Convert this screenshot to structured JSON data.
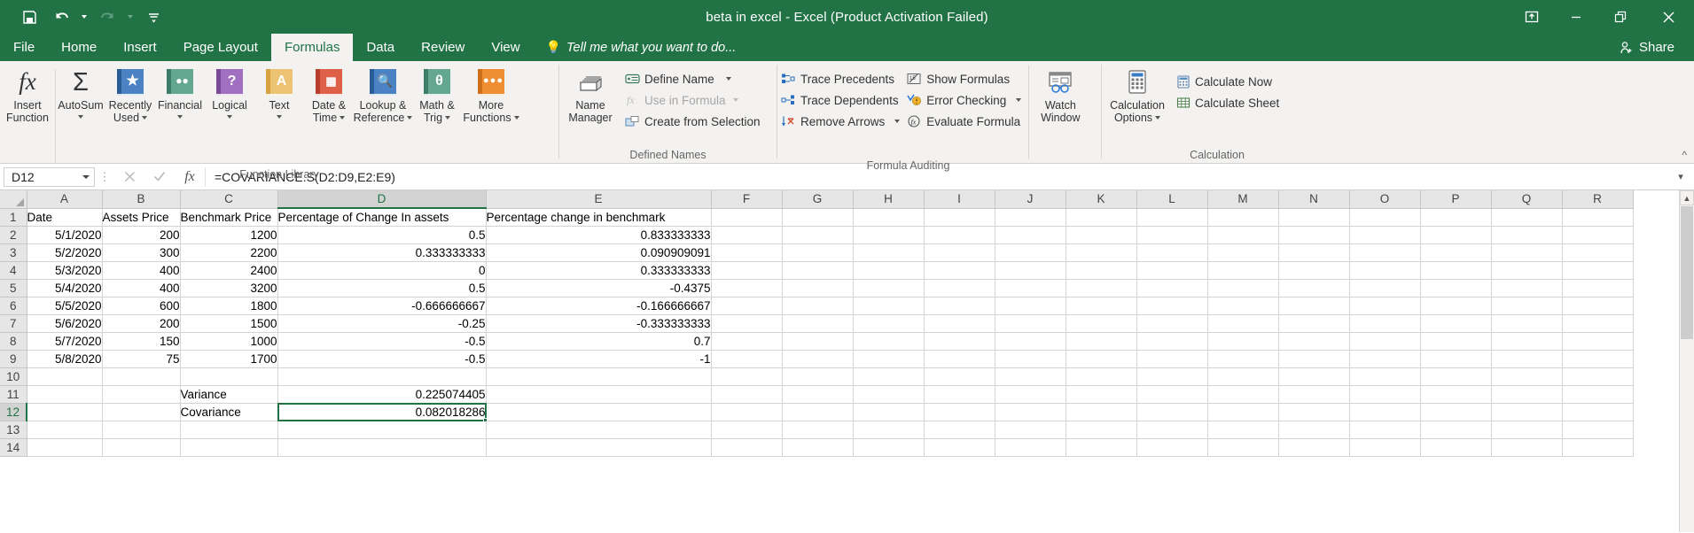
{
  "window": {
    "title": "beta in excel - Excel (Product Activation Failed)",
    "quick_access": [
      "save-icon",
      "undo-icon",
      "redo-icon",
      "customize-icon"
    ],
    "controls": {
      "ribbon_display": "ribbon-display-options-icon",
      "minimize": "minimize-icon",
      "restore": "restore-icon",
      "close": "close-icon"
    }
  },
  "tabs": {
    "items": [
      {
        "label": "File",
        "active": false
      },
      {
        "label": "Home",
        "active": false
      },
      {
        "label": "Insert",
        "active": false
      },
      {
        "label": "Page Layout",
        "active": false
      },
      {
        "label": "Formulas",
        "active": true
      },
      {
        "label": "Data",
        "active": false
      },
      {
        "label": "Review",
        "active": false
      },
      {
        "label": "View",
        "active": false
      }
    ],
    "tell_me": "Tell me what you want to do...",
    "share": "Share"
  },
  "ribbon": {
    "groups": [
      {
        "name": "Function Library",
        "label": "Function Library",
        "buttons": [
          {
            "label_line1": "Insert",
            "label_line2": "Function",
            "icon": "fx-icon",
            "caret": false,
            "color": ""
          },
          {
            "label_line1": "AutoSum",
            "label_line2": "",
            "icon": "sigma-icon",
            "caret": true,
            "color": ""
          },
          {
            "label_line1": "Recently",
            "label_line2": "Used",
            "icon": "star-book-icon",
            "caret": true,
            "color": "#3a6fb0"
          },
          {
            "label_line1": "Financial",
            "label_line2": "",
            "icon": "coins-book-icon",
            "caret": true,
            "color": "#4f9e86"
          },
          {
            "label_line1": "Logical",
            "label_line2": "",
            "icon": "question-book-icon",
            "caret": true,
            "color": "#9a62b5"
          },
          {
            "label_line1": "Text",
            "label_line2": "",
            "icon": "letter-a-book-icon",
            "caret": true,
            "color": "#e9b65b"
          },
          {
            "label_line1": "Date &",
            "label_line2": "Time",
            "icon": "calendar-book-icon",
            "caret": true,
            "color": "#d9503c"
          },
          {
            "label_line1": "Lookup &",
            "label_line2": "Reference",
            "icon": "magnifier-book-icon",
            "caret": true,
            "color": "#3a6fb0"
          },
          {
            "label_line1": "Math &",
            "label_line2": "Trig",
            "icon": "theta-book-icon",
            "caret": true,
            "color": "#4f9e86"
          },
          {
            "label_line1": "More",
            "label_line2": "Functions",
            "icon": "ellipsis-book-icon",
            "caret": true,
            "color": "#e8862a"
          }
        ]
      },
      {
        "name": "Defined Names",
        "label": "Defined Names",
        "big_button": {
          "label_line1": "Name",
          "label_line2": "Manager",
          "icon": "name-manager-icon"
        },
        "small_buttons": [
          {
            "label": "Define Name",
            "icon": "define-name-icon",
            "caret": true,
            "disabled": false
          },
          {
            "label": "Use in Formula",
            "icon": "use-in-formula-icon",
            "caret": true,
            "disabled": true
          },
          {
            "label": "Create from Selection",
            "icon": "create-from-selection-icon",
            "caret": false,
            "disabled": false
          }
        ]
      },
      {
        "name": "Formula Auditing",
        "label": "Formula Auditing",
        "small_buttons_col1": [
          {
            "label": "Trace Precedents",
            "icon": "trace-precedents-icon",
            "caret": false
          },
          {
            "label": "Trace Dependents",
            "icon": "trace-dependents-icon",
            "caret": false
          },
          {
            "label": "Remove Arrows",
            "icon": "remove-arrows-icon",
            "caret": true
          }
        ],
        "small_buttons_col2": [
          {
            "label": "Show Formulas",
            "icon": "show-formulas-icon",
            "caret": false
          },
          {
            "label": "Error Checking",
            "icon": "error-checking-icon",
            "caret": true
          },
          {
            "label": "Evaluate Formula",
            "icon": "evaluate-formula-icon",
            "caret": false
          }
        ],
        "watch_window": {
          "label_line1": "Watch",
          "label_line2": "Window",
          "icon": "watch-window-icon"
        }
      },
      {
        "name": "Calculation",
        "label": "Calculation",
        "big_button": {
          "label_line1": "Calculation",
          "label_line2": "Options",
          "icon": "calculator-icon",
          "caret": true
        },
        "small_buttons": [
          {
            "label": "Calculate Now",
            "icon": "calculate-now-icon"
          },
          {
            "label": "Calculate Sheet",
            "icon": "calculate-sheet-icon"
          }
        ]
      }
    ]
  },
  "formula_bar": {
    "name_box": "D12",
    "cancel_icon": "cancel-icon",
    "enter_icon": "confirm-icon",
    "fx_icon": "insert-function-icon",
    "formula": "=COVARIANCE.S(D2:D9,E2:E9)",
    "expand_icon": "expand-formula-bar-icon"
  },
  "sheet": {
    "columns": [
      "A",
      "B",
      "C",
      "D",
      "E",
      "F",
      "G",
      "H",
      "I",
      "J",
      "K",
      "L",
      "M",
      "N",
      "O",
      "P",
      "Q",
      "R"
    ],
    "active_column": "D",
    "active_row": 12,
    "selected_cell": "D12",
    "rows": [
      {
        "n": 1,
        "A": "Date",
        "B": "Assets Price",
        "C": "Benchmark Price",
        "D": "Percentage of Change In assets",
        "E": "Percentage change in benchmark"
      },
      {
        "n": 2,
        "A": "5/1/2020",
        "B": "200",
        "C": "1200",
        "D": "0.5",
        "E": "0.833333333"
      },
      {
        "n": 3,
        "A": "5/2/2020",
        "B": "300",
        "C": "2200",
        "D": "0.333333333",
        "E": "0.090909091"
      },
      {
        "n": 4,
        "A": "5/3/2020",
        "B": "400",
        "C": "2400",
        "D": "0",
        "E": "0.333333333"
      },
      {
        "n": 5,
        "A": "5/4/2020",
        "B": "400",
        "C": "3200",
        "D": "0.5",
        "E": "-0.4375"
      },
      {
        "n": 6,
        "A": "5/5/2020",
        "B": "600",
        "C": "1800",
        "D": "-0.666666667",
        "E": "-0.166666667"
      },
      {
        "n": 7,
        "A": "5/6/2020",
        "B": "200",
        "C": "1500",
        "D": "-0.25",
        "E": "-0.333333333"
      },
      {
        "n": 8,
        "A": "5/7/2020",
        "B": "150",
        "C": "1000",
        "D": "-0.5",
        "E": "0.7"
      },
      {
        "n": 9,
        "A": "5/8/2020",
        "B": "75",
        "C": "1700",
        "D": "-0.5",
        "E": "-1"
      },
      {
        "n": 10,
        "A": "",
        "B": "",
        "C": "",
        "D": "",
        "E": ""
      },
      {
        "n": 11,
        "A": "",
        "B": "",
        "C": "Variance",
        "D": "0.225074405",
        "E": ""
      },
      {
        "n": 12,
        "A": "",
        "B": "",
        "C": "Covariance",
        "D": "0.082018286",
        "E": ""
      },
      {
        "n": 13,
        "A": "",
        "B": "",
        "C": "",
        "D": "",
        "E": ""
      },
      {
        "n": 14,
        "A": "",
        "B": "",
        "C": "",
        "D": "",
        "E": ""
      }
    ]
  },
  "colors": {
    "excel_green": "#217346",
    "ribbon_bg": "#f3f2f1",
    "header_gray": "#e6e6e6",
    "gridline": "#d4d4d4"
  }
}
